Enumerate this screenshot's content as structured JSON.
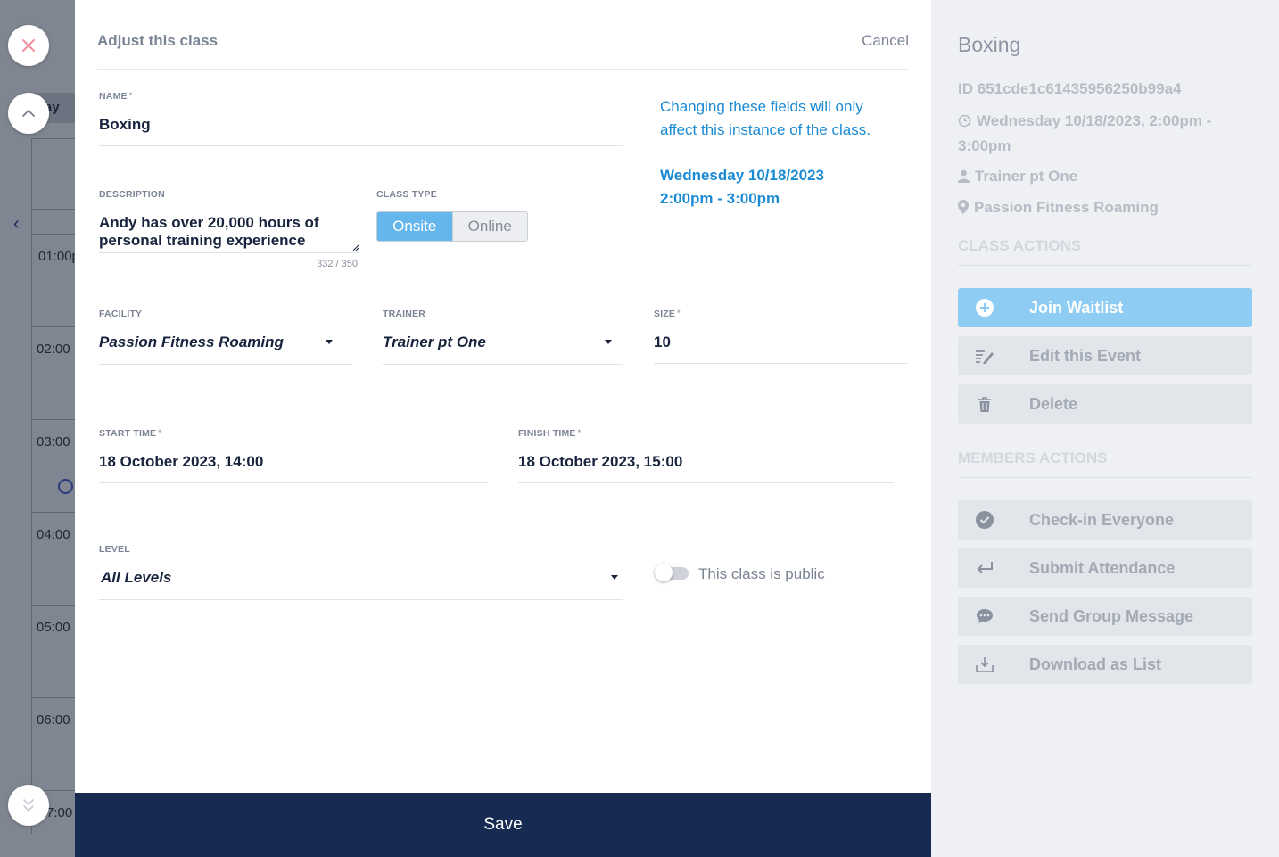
{
  "background_calendar": {
    "day_label": "ay",
    "times": [
      "01:00p",
      "02:00",
      "03:00",
      "04:00",
      "05:00",
      "06:00",
      "7:00"
    ]
  },
  "modal": {
    "title": "Adjust this class",
    "cancel_label": "Cancel",
    "name": {
      "label": "NAME",
      "required": "*",
      "value": "Boxing"
    },
    "description": {
      "label": "DESCRIPTION",
      "value": "Andy has over 20,000 hours of personal training experience",
      "counter": "332 / 350"
    },
    "class_type": {
      "label": "CLASS TYPE",
      "options": [
        "Onsite",
        "Online"
      ],
      "selected": "Onsite"
    },
    "info": {
      "note": "Changing these fields will only affect this instance of the class.",
      "date": "Wednesday 10/18/2023",
      "time": "2:00pm - 3:00pm"
    },
    "facility": {
      "label": "FACILITY",
      "value": "Passion Fitness Roaming"
    },
    "trainer": {
      "label": "TRAINER",
      "value": "Trainer pt One"
    },
    "size": {
      "label": "SIZE",
      "required": "*",
      "value": "10"
    },
    "start_time": {
      "label": "START TIME",
      "required": "*",
      "value": "18 October 2023, 14:00"
    },
    "finish_time": {
      "label": "FINISH TIME",
      "required": "*",
      "value": "18 October 2023, 15:00"
    },
    "level": {
      "label": "LEVEL",
      "value": "All Levels"
    },
    "public_toggle": {
      "label": "This class is public",
      "on": false
    },
    "save_label": "Save"
  },
  "details": {
    "title": "Boxing",
    "id_text": "ID 651cde1c61435956250b99a4",
    "datetime": "Wednesday 10/18/2023, 2:00pm - 3:00pm",
    "trainer": "Trainer pt One",
    "location": "Passion Fitness Roaming",
    "class_actions_title": "CLASS ACTIONS",
    "class_actions": [
      {
        "label": "Join Waitlist",
        "icon": "plus-circle-icon"
      },
      {
        "label": "Edit this Event",
        "icon": "edit-icon"
      },
      {
        "label": "Delete",
        "icon": "trash-icon"
      }
    ],
    "members_actions_title": "MEMBERS ACTIONS",
    "members_actions": [
      {
        "label": "Check-in Everyone",
        "icon": "check-circle-icon"
      },
      {
        "label": "Submit Attendance",
        "icon": "return-arrow-icon"
      },
      {
        "label": "Send Group Message",
        "icon": "chat-bubble-icon"
      },
      {
        "label": "Download as List",
        "icon": "download-icon"
      }
    ]
  },
  "colors": {
    "navy": "#172b52",
    "accent_blue": "#1a8ad2",
    "active_segment": "#64b6ec",
    "primary_action": "#8fccf3",
    "close_x": "#f0909c"
  }
}
